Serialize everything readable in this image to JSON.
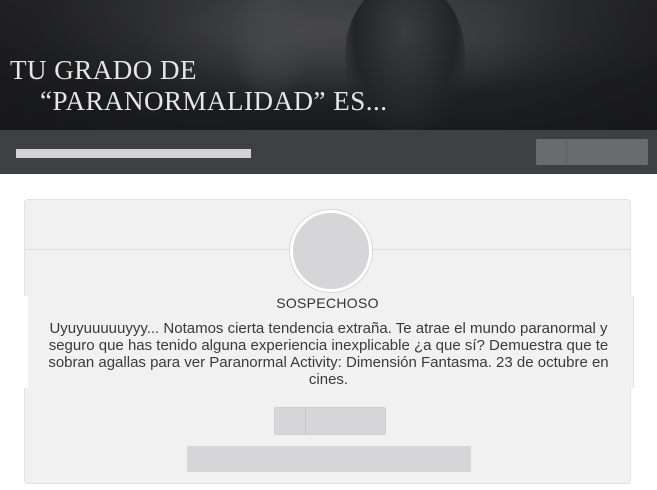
{
  "banner": {
    "title_line1": "TU GRADO DE",
    "title_line2": "“PARANORMALIDAD” ES..."
  },
  "result": {
    "name": "SOSPECHOSO",
    "description": "Uyuyuuuuuyyy... Notamos cierta tendencia extraña. Te atrae el mundo paranormal y seguro que has tenido alguna experiencia inexplicable ¿a que sí? Demuestra que te sobran agallas para ver Paranormal Activity: Dimensión Fantasma. 23 de octubre en cines."
  },
  "colors": {
    "banner_bg": "#1f2023",
    "toolbar_bg": "#3f4043",
    "card_bg": "#f1f1f1",
    "placeholder": "#d6d6d8"
  }
}
